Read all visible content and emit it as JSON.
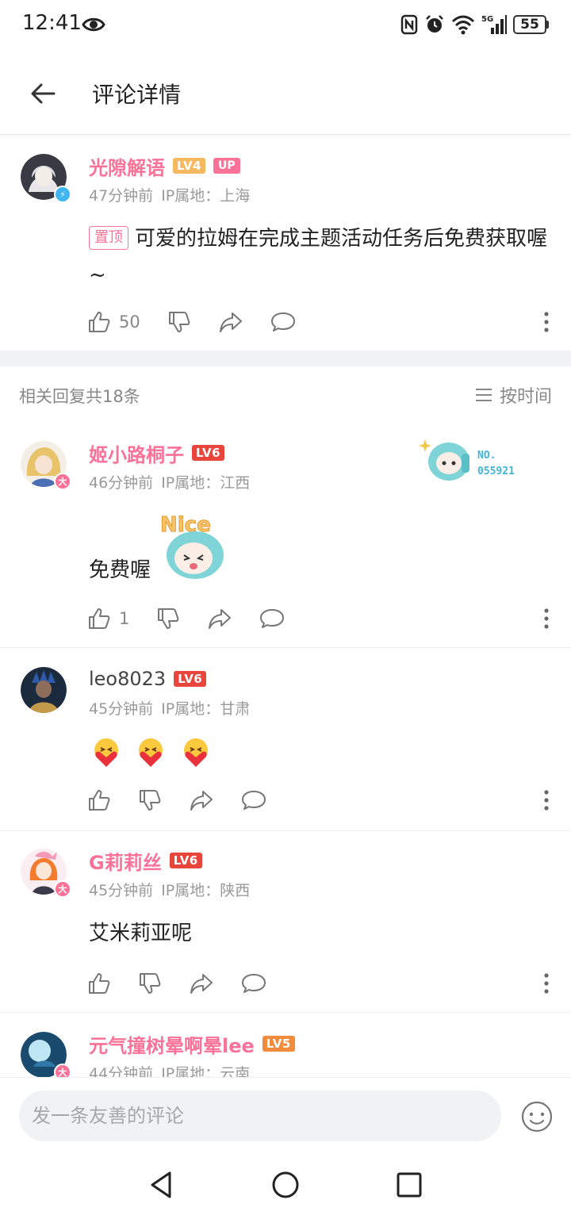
{
  "status_bar": {
    "time": "12:41",
    "battery": "55",
    "network": "5G"
  },
  "header": {
    "title": "评论详情"
  },
  "main_comment": {
    "user": "光隙解语",
    "level": "LV4",
    "up_badge": "UP",
    "time": "47分钟前",
    "ip": "IP属地：上海",
    "pin_label": "置顶",
    "text": "可爱的拉姆在完成主题活动任务后免费获取喔~",
    "likes": "50"
  },
  "replies_header": {
    "count_text": "相关回复共18条",
    "sort_label": "按时间"
  },
  "replies": [
    {
      "user": "姬小路桐子",
      "level": "LV6",
      "time": "46分钟前",
      "ip": "IP属地：江西",
      "text": "免费喔",
      "likes": "1",
      "sticker": "Nice",
      "fan_badge": "NO.\n055921",
      "badge_char": "大"
    },
    {
      "user": "leo8023",
      "level": "LV6",
      "time": "45分钟前",
      "ip": "IP属地：甘肃",
      "text": "",
      "likes": ""
    },
    {
      "user": "G莉莉丝",
      "level": "LV6",
      "time": "45分钟前",
      "ip": "IP属地：陕西",
      "text": "艾米莉亚呢",
      "likes": "",
      "badge_char": "大"
    },
    {
      "user": "元气撞树晕啊晕lee",
      "level": "LV5",
      "time": "44分钟前",
      "ip": "IP属地：云南",
      "badge_char": "大"
    }
  ],
  "fan_badge": {
    "line1": "NO.",
    "line2": "055921"
  },
  "input": {
    "placeholder": "发一条友善的评论"
  },
  "colors": {
    "accent": "#fb7299",
    "lv4": "#f5b95f",
    "lv5": "#f08c3c",
    "lv6": "#e8453c",
    "meta": "#9a9a9a"
  }
}
